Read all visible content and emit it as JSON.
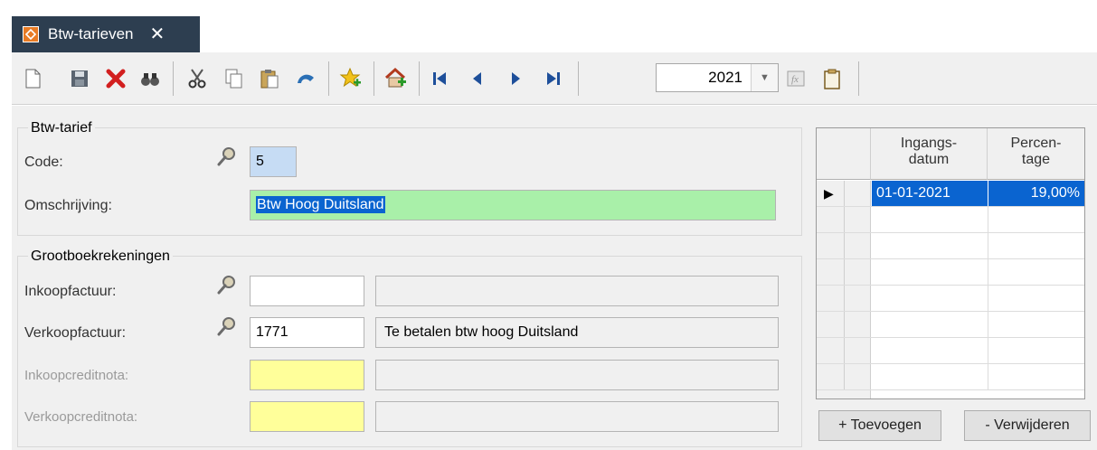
{
  "tab": {
    "title": "Btw-tarieven",
    "close_glyph": "✕",
    "icon": "app-logo-icon"
  },
  "toolbar": {
    "buttons": [
      "new-document-icon",
      "save-icon",
      "delete-icon",
      "find-binoculars-icon",
      "cut-icon",
      "copy-icon",
      "paste-icon",
      "undo-icon",
      "favorite-add-icon",
      "home-add-icon",
      "first-record-icon",
      "previous-record-icon",
      "next-record-icon",
      "last-record-icon",
      "formula-icon",
      "clipboard-icon"
    ],
    "year": "2021"
  },
  "btw_tarief": {
    "title": "Btw-tarief",
    "code_label": "Code:",
    "code_value": "5",
    "omschrijving_label": "Omschrijving:",
    "omschrijving_value": "Btw Hoog Duitsland"
  },
  "grootboek": {
    "title": "Grootboekrekeningen",
    "inkoopfactuur_label": "Inkoopfactuur:",
    "inkoopfactuur_code": "",
    "inkoopfactuur_desc": "",
    "verkoopfactuur_label": "Verkoopfactuur:",
    "verkoopfactuur_code": "1771",
    "verkoopfactuur_desc": "Te betalen btw hoog Duitsland",
    "inkoopcreditnota_label": "Inkoopcreditnota:",
    "inkoopcreditnota_code": "",
    "inkoopcreditnota_desc": "",
    "verkoopcreditnota_label": "Verkoopcreditnota:",
    "verkoopcreditnota_code": "",
    "verkoopcreditnota_desc": ""
  },
  "grid": {
    "col_ingang_l1": "Ingangs-",
    "col_ingang_l2": "datum",
    "col_perc_l1": "Percen-",
    "col_perc_l2": "tage",
    "current_row_marker": "▶",
    "rows": [
      {
        "ingangsdatum": "01-01-2021",
        "percentage": "19,00%"
      }
    ]
  },
  "buttons": {
    "add": "+ Toevoegen",
    "remove": "- Verwijderen"
  },
  "colors": {
    "tab_bg": "#2d3e50",
    "selection": "#0a64d0",
    "code_bg": "#c6dcf4",
    "desc_bg": "#a9f0a9",
    "required_bg": "#ffff9a"
  }
}
